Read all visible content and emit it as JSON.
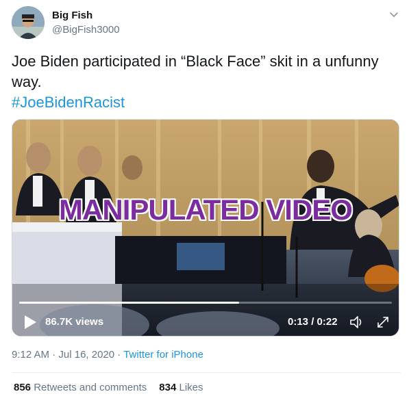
{
  "author": {
    "name": "Big Fish",
    "handle": "@BigFish3000"
  },
  "tweet": {
    "text": "Joe Biden participated in “Black Face” skit in a unfunny way.",
    "hashtag": "#JoeBidenRacist"
  },
  "video": {
    "overlay_label": "MANIPULATED VIDEO",
    "views": "86.7K views",
    "time": "0:13 / 0:22",
    "progress": 0.59
  },
  "meta": {
    "time": "9:12 AM",
    "date": "Jul 16, 2020",
    "separator": "·",
    "source": "Twitter for iPhone"
  },
  "stats": {
    "retweets_count": "856",
    "retweets_label": "Retweets and comments",
    "likes_count": "834",
    "likes_label": "Likes"
  },
  "icons": {
    "caret": "chevron-down-icon",
    "play": "play-icon",
    "volume": "volume-icon",
    "expand": "expand-icon"
  },
  "colors": {
    "link": "#1b95e0",
    "overlay": "#7b2d9f",
    "muted": "#657786"
  }
}
